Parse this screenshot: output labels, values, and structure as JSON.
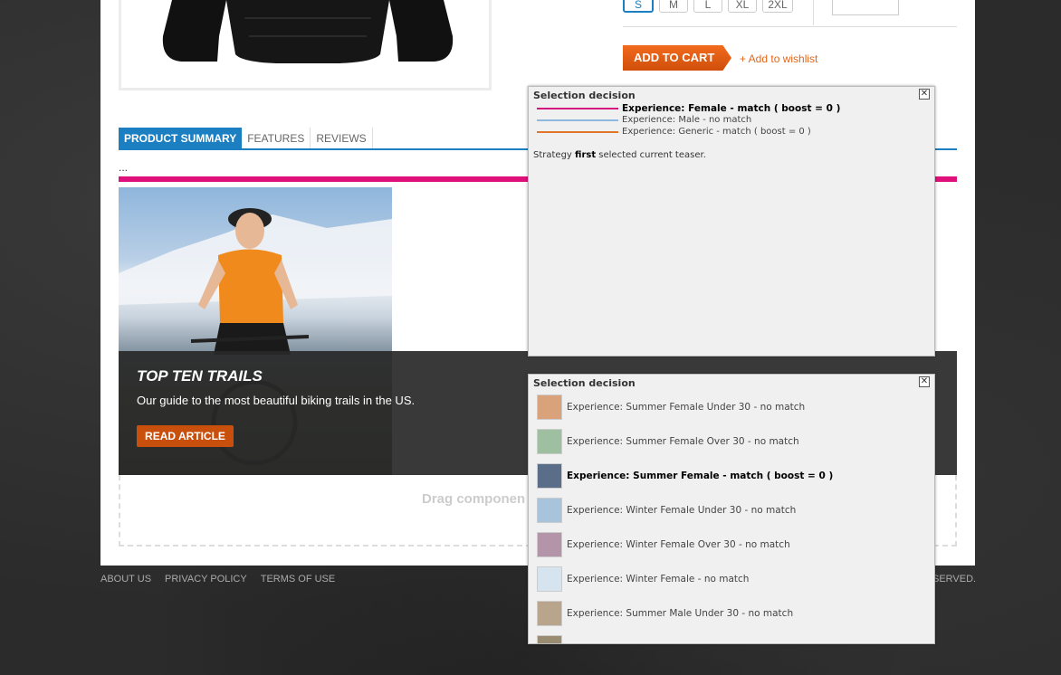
{
  "product": {
    "sizes": [
      {
        "label": "S",
        "selected": true
      },
      {
        "label": "M",
        "selected": false
      },
      {
        "label": "L",
        "selected": false
      },
      {
        "label": "XL",
        "selected": false
      },
      {
        "label": "2XL",
        "selected": false
      }
    ],
    "add_to_cart": "ADD TO CART",
    "wishlist": "+ Add to wishlist"
  },
  "tabs": [
    "PRODUCT SUMMARY",
    "FEATURES",
    "REVIEWS"
  ],
  "summary_text": "...",
  "teaser": {
    "title": "TOP TEN TRAILS",
    "text": "Our guide to the most beautiful biking trails in the US.",
    "button": "READ ARTICLE"
  },
  "dropzone": {
    "text": "Drag componen"
  },
  "footer": {
    "links": [
      "ABOUT US",
      "PRIVACY POLICY",
      "TERMS OF USE"
    ],
    "rights": "SERVED."
  },
  "popup1": {
    "title": "Selection decision",
    "experiences": [
      {
        "label": "Experience: Female - match ( boost = 0 )",
        "color": "#d4147e",
        "bold": true
      },
      {
        "label": "Experience: Male - no match",
        "color": "#8fb8de",
        "bold": false
      },
      {
        "label": "Experience: Generic - match ( boost = 0 )",
        "color": "#e0762a",
        "bold": false
      }
    ],
    "strategy_prefix": "Strategy ",
    "strategy_name": "first",
    "strategy_suffix": " selected current teaser."
  },
  "popup2": {
    "title": "Selection decision",
    "items": [
      {
        "label": "Experience: Summer Female Under 30 - no match",
        "bold": false,
        "thumb_color": "#d9a27a"
      },
      {
        "label": "Experience: Summer Female Over 30 - no match",
        "bold": false,
        "thumb_color": "#9fc0a0"
      },
      {
        "label": "Experience: Summer Female - match ( boost = 0 )",
        "bold": true,
        "thumb_color": "#5a6e8a"
      },
      {
        "label": "Experience: Winter Female Under 30 - no match",
        "bold": false,
        "thumb_color": "#a8c4dc"
      },
      {
        "label": "Experience: Winter Female Over 30 - no match",
        "bold": false,
        "thumb_color": "#b494a8"
      },
      {
        "label": "Experience: Winter Female - no match",
        "bold": false,
        "thumb_color": "#d6e4ef"
      },
      {
        "label": "Experience: Summer Male Under 30 - no match",
        "bold": false,
        "thumb_color": "#b8a58c"
      }
    ]
  }
}
